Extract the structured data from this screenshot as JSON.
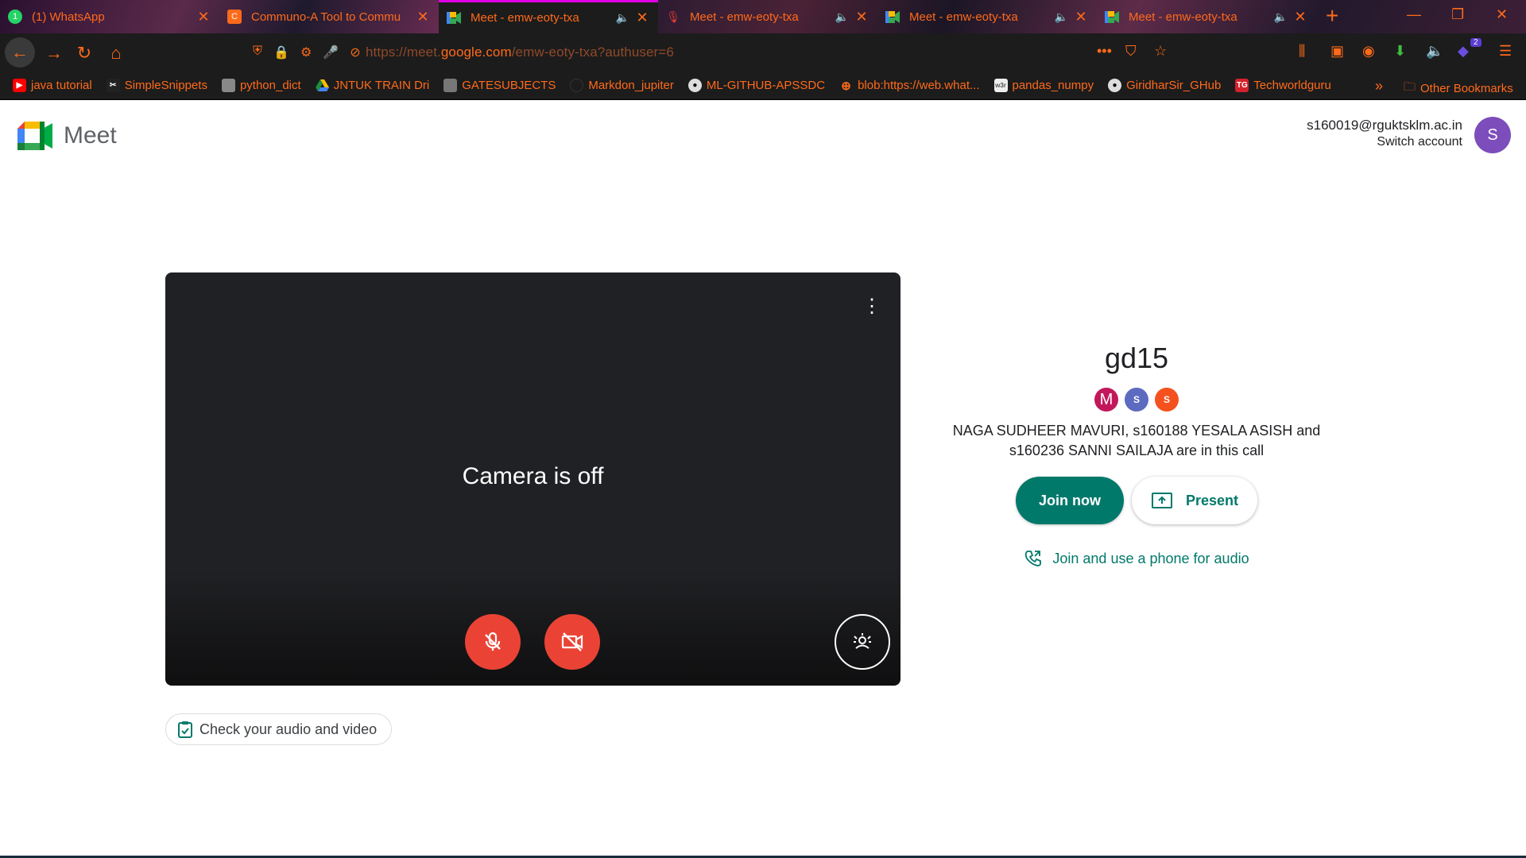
{
  "browser": {
    "tabs": [
      {
        "title": "(1) WhatsApp",
        "favicon": "whatsapp-icon",
        "audio": false,
        "active": false
      },
      {
        "title": "Communo-A Tool to Commu",
        "favicon": "communo-icon",
        "audio": false,
        "active": false
      },
      {
        "title": "Meet - emw-eoty-txa",
        "favicon": "meet-icon",
        "audio": true,
        "active": true
      },
      {
        "title": "Meet - emw-eoty-txa",
        "favicon": "mic-icon",
        "audio": true,
        "active": false
      },
      {
        "title": "Meet - emw-eoty-txa",
        "favicon": "meet-icon",
        "audio": true,
        "active": false
      },
      {
        "title": "Meet - emw-eoty-txa",
        "favicon": "meet-icon",
        "audio": true,
        "active": false
      }
    ],
    "url_prefix": "https://meet.",
    "url_host": "google.com",
    "url_path": "/emw-eoty-txa?authuser=6",
    "extension_badge": "2",
    "bookmarks": [
      {
        "label": "java tutorial",
        "icon": "youtube-icon",
        "color": "#ff0000"
      },
      {
        "label": "SimpleSnippets",
        "icon": "snippets-icon",
        "color": "#222222"
      },
      {
        "label": "python_dict",
        "icon": "page-icon",
        "color": "#888888"
      },
      {
        "label": "JNTUK TRAIN Dri",
        "icon": "drive-icon",
        "color": "#1e8e3e"
      },
      {
        "label": "GATESUBJECTS",
        "icon": "page-icon",
        "color": "#777777"
      },
      {
        "label": "Markdon_jupiter",
        "icon": "github-icon",
        "color": "#1c1c1c"
      },
      {
        "label": "ML-GITHUB-APSSDC",
        "icon": "github-icon",
        "color": "#444444"
      },
      {
        "label": "blob:https://web.what...",
        "icon": "globe-icon",
        "color": "#1c1c1c"
      },
      {
        "label": "pandas_numpy",
        "icon": "w3-icon",
        "color": "#dddddd"
      },
      {
        "label": "GiridharSir_GHub",
        "icon": "github-icon",
        "color": "#444444"
      },
      {
        "label": "Techworldguru",
        "icon": "tg-icon",
        "color": "#d3212c"
      }
    ],
    "other_bookmarks": "Other Bookmarks"
  },
  "meet": {
    "brand": "Meet",
    "account_email": "s160019@rguktsklm.ac.in",
    "switch_account": "Switch account",
    "avatar_letter": "S",
    "camera_status": "Camera is off",
    "check_av": "Check your audio and video",
    "meeting_name": "gd15",
    "participants": [
      {
        "letter": "M",
        "color": "#c2185b"
      },
      {
        "letter": "S",
        "color": "#5c6bc0"
      },
      {
        "letter": "S",
        "color": "#f4511e"
      }
    ],
    "in_call_text": "NAGA SUDHEER MAVURI, s160188 YESALA ASISH and s160236 SANNI SAILAJA are in this call",
    "join_now": "Join now",
    "present": "Present",
    "phone_audio": "Join and use a phone for audio"
  },
  "colors": {
    "accent": "#00796b",
    "danger": "#ea4335",
    "chrome_text": "#ff6a1a"
  }
}
